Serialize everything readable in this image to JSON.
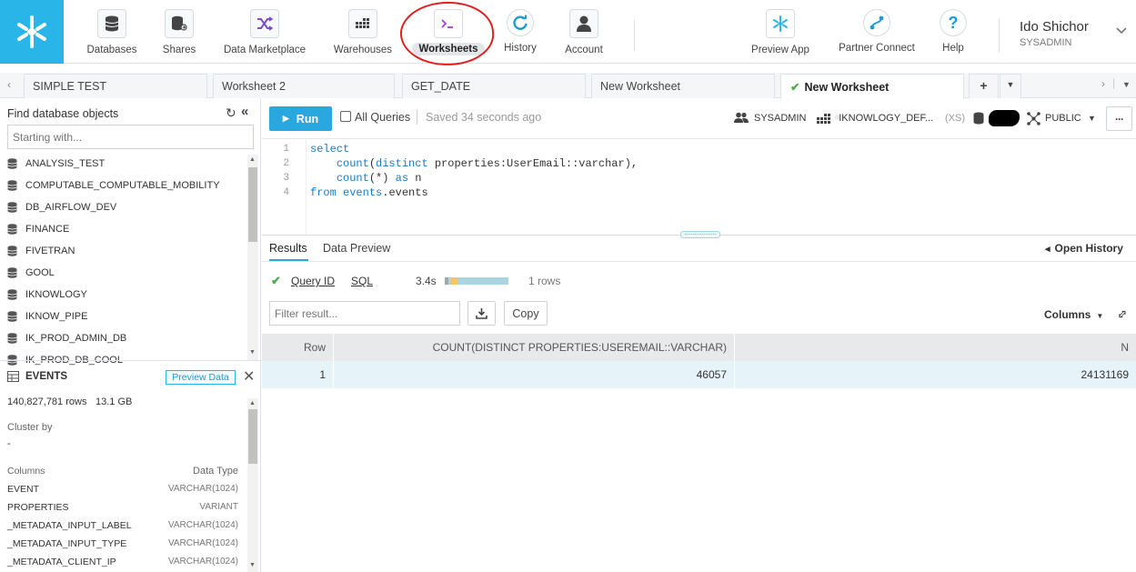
{
  "nav": {
    "items": [
      {
        "label": "Databases",
        "icon": "database-icon"
      },
      {
        "label": "Shares",
        "icon": "share-database-icon"
      },
      {
        "label": "Data Marketplace",
        "icon": "marketplace-shuffle-icon"
      },
      {
        "label": "Warehouses",
        "icon": "warehouse-grid-icon"
      },
      {
        "label": "Worksheets",
        "icon": "terminal-icon"
      },
      {
        "label": "History",
        "icon": "history-refresh-icon"
      },
      {
        "label": "Account",
        "icon": "account-person-icon"
      },
      {
        "label": "Preview App",
        "icon": "snowflake-icon"
      },
      {
        "label": "Partner Connect",
        "icon": "partner-connect-icon"
      },
      {
        "label": "Help",
        "icon": "help-question-icon"
      }
    ],
    "user_name": "Ido Shichor",
    "user_role": "SYSADMIN"
  },
  "tabs": [
    {
      "label": "SIMPLE TEST"
    },
    {
      "label": "Worksheet 2"
    },
    {
      "label": "GET_DATE"
    },
    {
      "label": "New Worksheet"
    },
    {
      "label": "New Worksheet"
    }
  ],
  "tabbar": {
    "add_label": "+"
  },
  "sidebar": {
    "header": "Find database objects",
    "search_placeholder": "Starting with...",
    "databases": [
      "ANALYSIS_TEST",
      "COMPUTABLE_COMPUTABLE_MOBILITY",
      "DB_AIRFLOW_DEV",
      "FINANCE",
      "FIVETRAN",
      "GOOL",
      "IKNOWLOGY",
      "IKNOW_PIPE",
      "IK_PROD_ADMIN_DB",
      "IK_PROD_DB_COOL"
    ],
    "table": {
      "name": "EVENTS",
      "preview_label": "Preview Data",
      "rows": "140,827,781 rows",
      "size": "13.1 GB",
      "cluster_label": "Cluster by",
      "cluster_value": "-",
      "columns_header": "Columns",
      "type_header": "Data Type",
      "columns": [
        {
          "name": "EVENT",
          "type": "VARCHAR(1024)"
        },
        {
          "name": "PROPERTIES",
          "type": "VARIANT"
        },
        {
          "name": "_METADATA_INPUT_LABEL",
          "type": "VARCHAR(1024)"
        },
        {
          "name": "_METADATA_INPUT_TYPE",
          "type": "VARCHAR(1024)"
        },
        {
          "name": "_METADATA_CLIENT_IP",
          "type": "VARCHAR(1024)"
        }
      ]
    }
  },
  "toolbar": {
    "run_label": "Run",
    "all_queries_label": "All Queries",
    "saved_text": "Saved 34 seconds ago",
    "role": "SYSADMIN",
    "warehouse": "IKNOWLOGY_DEF...",
    "warehouse_size": "(XS)",
    "schema": "PUBLIC",
    "more_label": "···"
  },
  "editor": {
    "lines": [
      {
        "num": "1",
        "text": "select"
      },
      {
        "num": "2",
        "text": "    count(distinct properties:UserEmail::varchar),"
      },
      {
        "num": "3",
        "text": "    count(*) as n"
      },
      {
        "num": "4",
        "text": "from events.events"
      }
    ]
  },
  "results": {
    "tab_results": "Results",
    "tab_preview": "Data Preview",
    "open_history": "Open History",
    "query_id_label": "Query ID",
    "sql_label": "SQL",
    "duration": "3.4s",
    "row_count": "1 rows",
    "filter_placeholder": "Filter result...",
    "copy_label": "Copy",
    "columns_label": "Columns",
    "headers": [
      "Row",
      "COUNT(DISTINCT PROPERTIES:USEREMAIL::VARCHAR)",
      "N"
    ],
    "rows": [
      [
        "1",
        "46057",
        "24131169"
      ]
    ]
  },
  "colors": {
    "brand": "#29b5e8",
    "run_button": "#29a8e0",
    "selected_row": "#e6f4f9",
    "header_row": "#e7e9eb",
    "success": "#4caf50"
  }
}
